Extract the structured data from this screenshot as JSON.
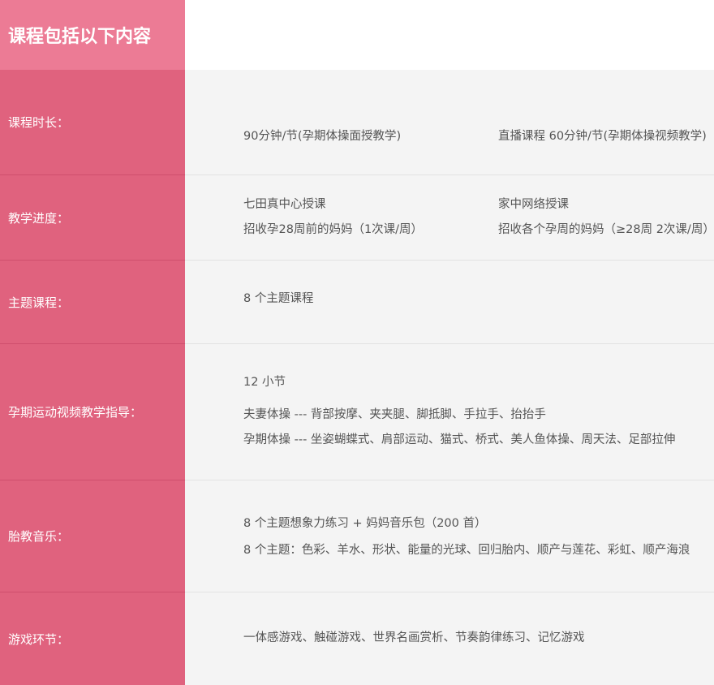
{
  "header": {
    "title": "课程包括以下内容"
  },
  "rows": [
    {
      "label": "课程时长：",
      "col1": [
        "90分钟/节(孕期体操面授教学)"
      ],
      "col2": [
        "直播课程 60分钟/节(孕期体操视频教学)"
      ]
    },
    {
      "label": "教学进度：",
      "col1": [
        "七田真中心授课",
        "招收孕28周前的妈妈（1次课/周）"
      ],
      "col2": [
        "家中网络授课",
        "招收各个孕周的妈妈（≥28周  2次课/周）"
      ]
    },
    {
      "label": "主题课程：",
      "lines": [
        "8 个主题课程"
      ]
    },
    {
      "label": "孕期运动视频教学指导：",
      "lines": [
        "12 小节",
        "夫妻体操 --- 背部按摩、夹夹腿、脚抵脚、手拉手、抬抬手",
        "孕期体操 --- 坐姿蝴蝶式、肩部运动、猫式、桥式、美人鱼体操、周天法、足部拉伸"
      ]
    },
    {
      "label": "胎教音乐：",
      "lines": [
        "8 个主题想象力练习 + 妈妈音乐包（200 首）",
        "8 个主题：色彩、羊水、形状、能量的光球、回归胎内、顺产与莲花、彩虹、顺产海浪"
      ]
    },
    {
      "label": "游戏环节：",
      "lines": [
        "一体感游戏、触碰游戏、世界名画赏析、节奏韵律练习、记忆游戏"
      ]
    }
  ]
}
